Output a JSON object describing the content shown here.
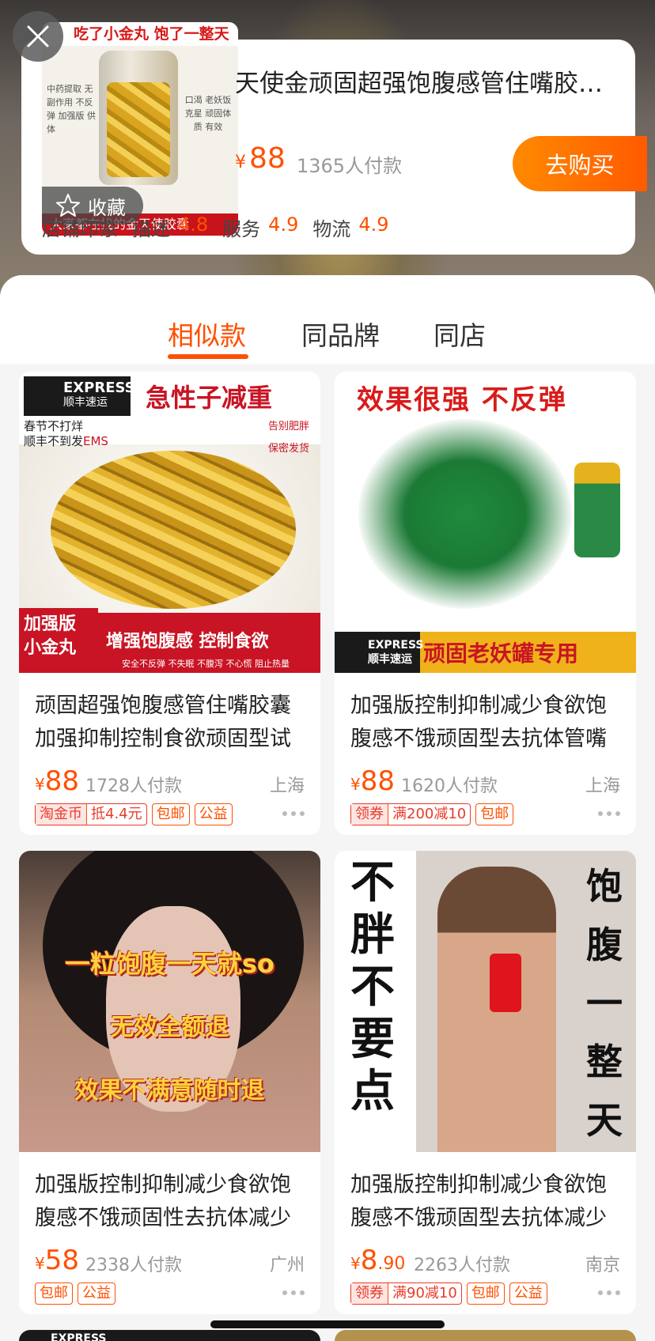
{
  "close_icon": "close-icon",
  "product": {
    "thumb_head": "吃了小金丸 饱了一整天",
    "thumb_left": "中药提取 无副作用 不反弹 加强版 供体",
    "thumb_right": "口渴 老妖饭克星 顽固体质 有效",
    "thumb_foot": "大家都在找的金天使胶囊",
    "favorite_label": "收藏",
    "title": "天使金顽固超强饱腹感管住嘴胶…",
    "currency": "¥",
    "price": "88",
    "sales": "1365人付款",
    "buy_label": "去购买",
    "ratings": {
      "shop_label": "店铺印象",
      "desc_label": "描述",
      "desc_value": "4.8",
      "service_label": "服务",
      "service_value": "4.9",
      "logistics_label": "物流",
      "logistics_value": "4.9"
    }
  },
  "tabs": [
    {
      "label": "相似款",
      "active": true
    },
    {
      "label": "同品牌",
      "active": false
    },
    {
      "label": "同店",
      "active": false
    }
  ],
  "cards": [
    {
      "art": {
        "sf": "EXPRESS",
        "sf_cn": "顺丰速运",
        "headline": "急性子减重",
        "note1": "春节不打烊",
        "note2": "顺丰不到发",
        "ems": "EMS",
        "chip1": "告别肥胖",
        "chip2": "保密发货",
        "badge1": "加强版",
        "badge2": "小金丸",
        "slogan": "增强饱腹感 控制食欲",
        "slogan2": "安全不反弹 不失眠 不腹泻 不心慌 阻止热量"
      },
      "title": "顽固超强饱腹感管住嘴胶囊加强抑制控制食欲顽固型试",
      "currency": "¥",
      "price": "88",
      "price_dec": "",
      "sales": "1728人付款",
      "location": "上海",
      "tags": [
        {
          "lead": "淘金币",
          "text": "抵4.4元",
          "red": true
        },
        {
          "lead": "",
          "text": "包邮",
          "red": false
        },
        {
          "lead": "",
          "text": "公益",
          "red": false
        }
      ]
    },
    {
      "art": {
        "headline": "效果很强 不反弹",
        "sf": "EXPRESS",
        "sf_cn": "顺丰速运",
        "slogan": "顽固老妖罐专用"
      },
      "title": "加强版控制抑制减少食欲饱腹感不饿顽固型去抗体管嘴",
      "currency": "¥",
      "price": "88",
      "price_dec": "",
      "sales": "1620人付款",
      "location": "上海",
      "tags": [
        {
          "lead": "领券",
          "text": "满200减10",
          "red": true
        },
        {
          "lead": "",
          "text": "包邮",
          "red": false
        }
      ]
    },
    {
      "art": {
        "line1": "一粒饱腹一天就so",
        "line2": "无效全额退",
        "line3": "效果不满意随时退"
      },
      "title": "加强版控制抑制减少食欲饱腹感不饿顽固性去抗体减少",
      "currency": "¥",
      "price": "58",
      "price_dec": "",
      "sales": "2338人付款",
      "location": "广州",
      "tags": [
        {
          "lead": "",
          "text": "包邮",
          "red": false
        },
        {
          "lead": "",
          "text": "公益",
          "red": false
        }
      ]
    },
    {
      "art": {
        "left": "不胖不要点",
        "right": "饱腹一整天"
      },
      "title": "加强版控制抑制减少食欲饱腹感不饿顽固型去抗体减少",
      "currency": "¥",
      "price": "8",
      "price_dec": ".90",
      "sales": "2263人付款",
      "location": "南京",
      "tags": [
        {
          "lead": "领券",
          "text": "满90减10",
          "red": true
        },
        {
          "lead": "",
          "text": "包邮",
          "red": false
        },
        {
          "lead": "",
          "text": "公益",
          "red": false
        }
      ]
    }
  ],
  "peek_sf": "EXPRESS",
  "colors": {
    "accent": "#ff5000",
    "tag_red": "#e93b2c"
  }
}
